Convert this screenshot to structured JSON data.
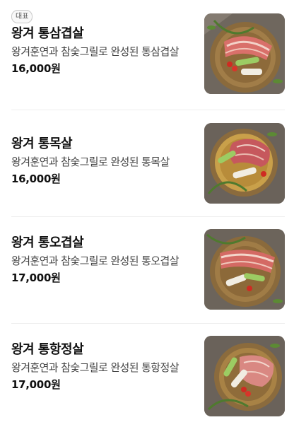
{
  "menu": {
    "items": [
      {
        "badge": "대표",
        "name": "왕겨 통삼겹살",
        "description": "왕겨훈연과 참숯그릴로 완성된 통삼겹살",
        "price": "16,000원"
      },
      {
        "name": "왕겨 통목살",
        "description": "왕겨훈연과 참숯그릴로 완성된 통목살",
        "price": "16,000원"
      },
      {
        "name": "왕겨 통오겹살",
        "description": "왕겨훈연과 참숯그릴로 완성된 통오겹살",
        "price": "17,000원"
      },
      {
        "name": "왕겨 통항정살",
        "description": "왕겨훈연과 참숯그릴로 완성된 통항정살",
        "price": "17,000원"
      }
    ]
  },
  "colors": {
    "text": "#111111",
    "description": "#444444",
    "divider": "#eeeeee",
    "badge_border": "#c8c8c8"
  }
}
